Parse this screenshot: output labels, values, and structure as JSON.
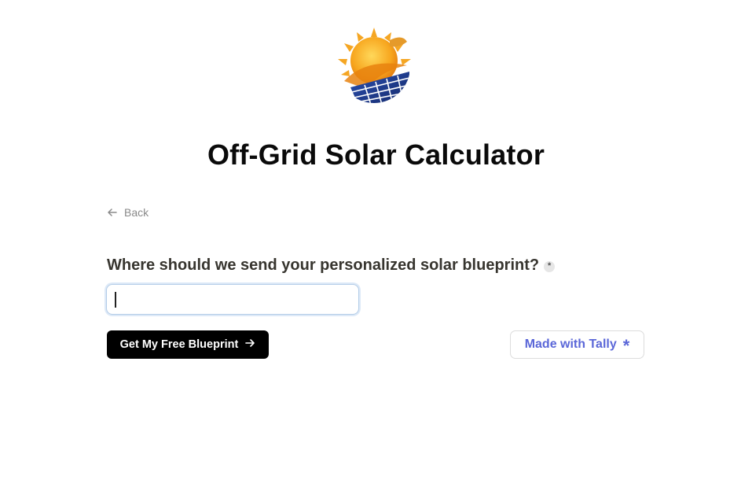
{
  "logo": {
    "icon": "solar-sun-panel-logo",
    "colors": {
      "sun": "#f7a51d",
      "sun_core": "#f9c33b",
      "panel": "#1e3a8a"
    }
  },
  "header": {
    "title": "Off-Grid Solar Calculator"
  },
  "nav": {
    "back_label": "Back",
    "back_icon": "arrow-left-icon"
  },
  "form": {
    "question": "Where should we send your personalized solar blueprint?",
    "required_symbol": "*",
    "input_value": "",
    "submit_label": "Get My Free Blueprint",
    "submit_icon": "arrow-right-icon"
  },
  "badge": {
    "label": "Made with Tally",
    "icon": "tally-star-icon",
    "color": "#5b67d8"
  }
}
